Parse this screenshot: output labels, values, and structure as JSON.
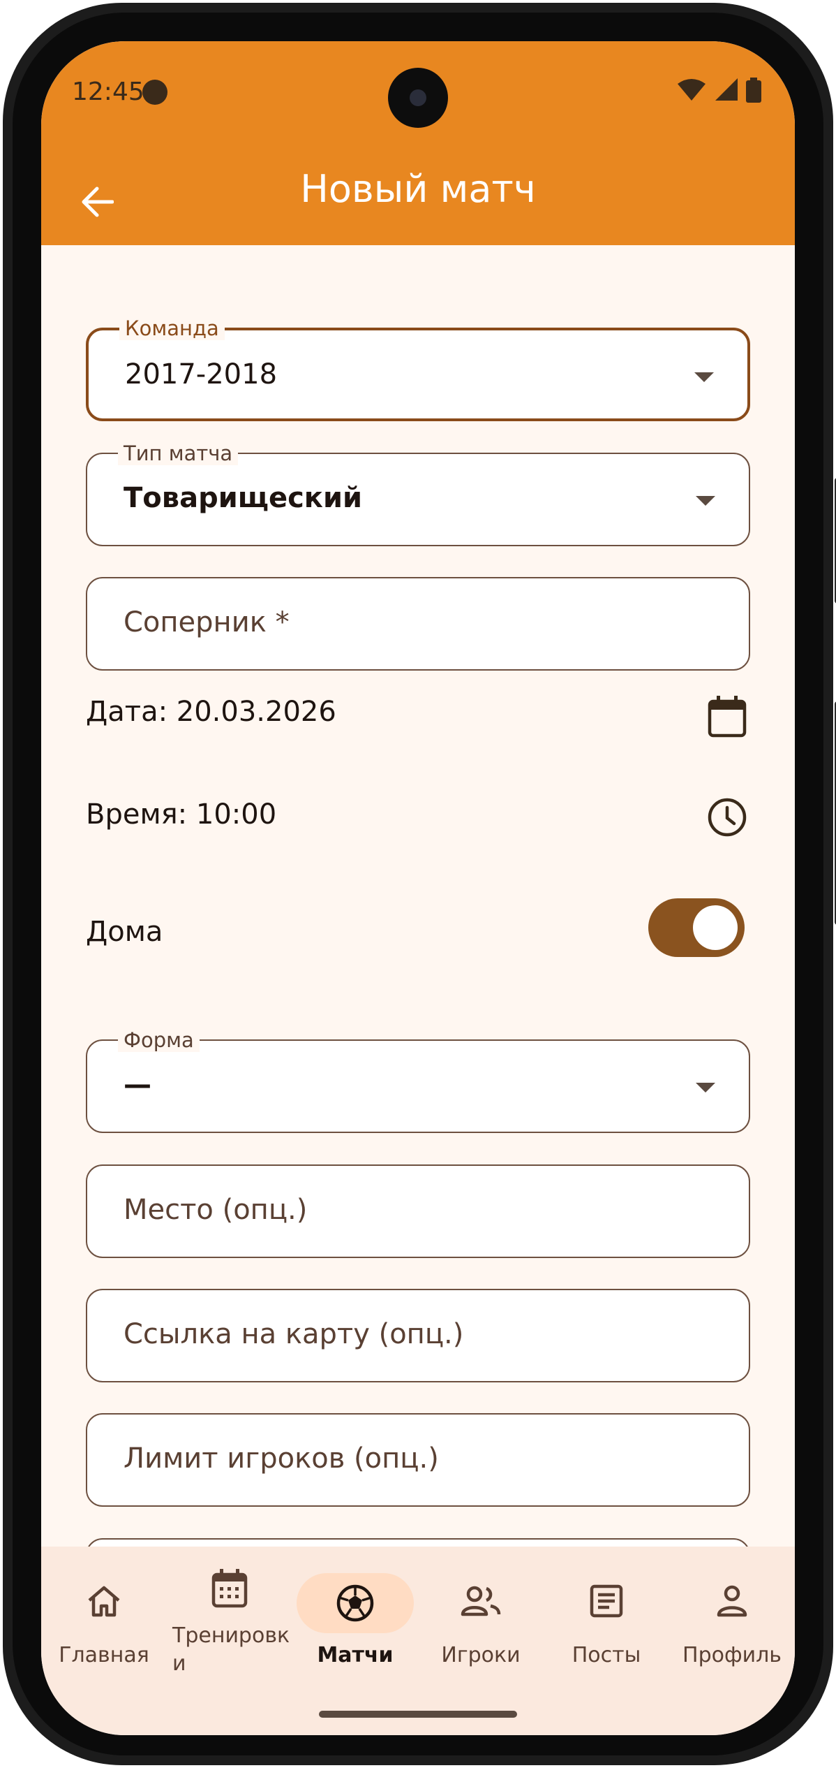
{
  "status_bar": {
    "time": "12:45"
  },
  "app_bar": {
    "title": "Новый матч"
  },
  "form": {
    "team": {
      "label": "Команда",
      "value": "2017-2018"
    },
    "match_type": {
      "label": "Тип матча",
      "value": "Товарищеский"
    },
    "opponent": {
      "placeholder": "Соперник *"
    },
    "date": {
      "text": "Дата: 20.03.2026"
    },
    "time": {
      "text": "Время: 10:00"
    },
    "home": {
      "label": "Дома",
      "on": true
    },
    "uniform": {
      "label": "Форма",
      "value": "—"
    },
    "place": {
      "placeholder": "Место (опц.)"
    },
    "map_link": {
      "placeholder": "Ссылка на карту (опц.)"
    },
    "player_limit": {
      "placeholder": "Лимит игроков (опц.)"
    }
  },
  "bottom_nav": {
    "items": [
      {
        "label": "Главная",
        "icon": "home-icon"
      },
      {
        "label": "Тренировк\nи",
        "icon": "calendar-icon"
      },
      {
        "label": "Матчи",
        "icon": "soccer-ball-icon",
        "active": true
      },
      {
        "label": "Игроки",
        "icon": "people-icon"
      },
      {
        "label": "Посты",
        "icon": "article-icon"
      },
      {
        "label": "Профиль",
        "icon": "person-icon"
      }
    ]
  },
  "colors": {
    "accent": "#e88720",
    "toggle": "#8a531f",
    "background": "#fff7f1",
    "nav_bg": "#fbe9de",
    "pill": "#ffdcc3"
  }
}
